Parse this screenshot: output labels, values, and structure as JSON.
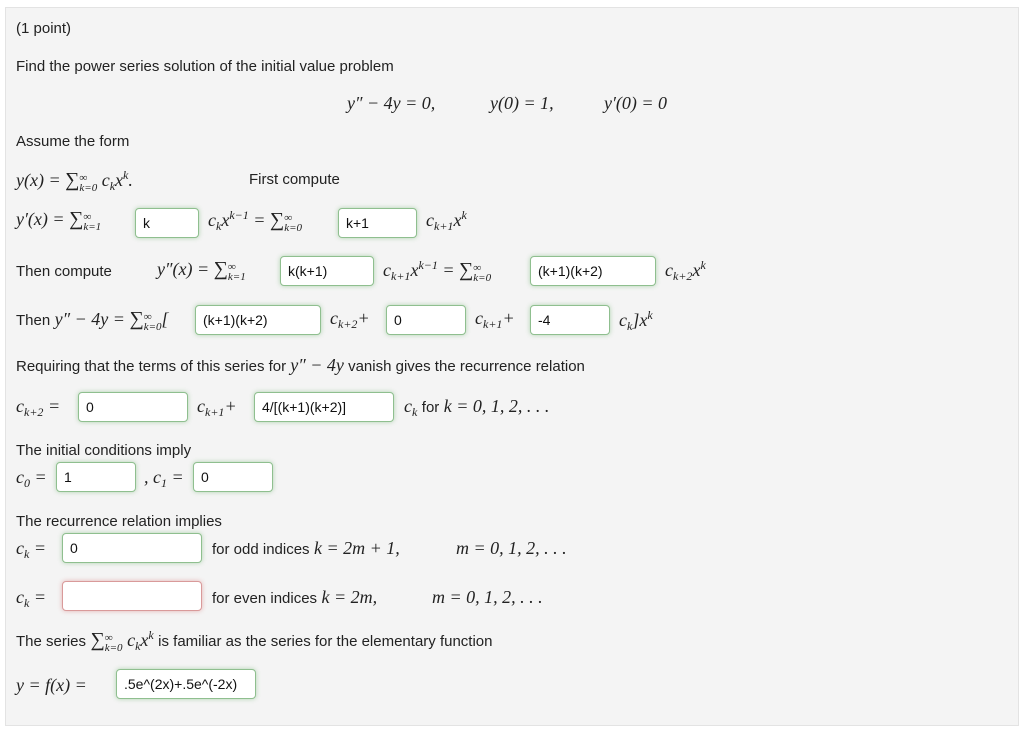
{
  "problem": {
    "points": "(1 point)",
    "intro": "Find the power series solution of the initial value problem",
    "equation": {
      "ode": "y″ − 4y = 0,",
      "ic1": "y(0) = 1,",
      "ic2": "y′(0) = 0"
    },
    "assume": "Assume the form",
    "first_compute": "First compute",
    "then_compute": "Then compute",
    "then": "Then",
    "requiring": "Requiring that the terms of this series for",
    "requiring_math": "y″ − 4y",
    "requiring_end": "vanish gives the recurrence relation",
    "for_k": "for",
    "k_range": "k = 0, 1, 2, . . .",
    "initial_conditions": "The initial conditions imply",
    "recurrence_implies": "The recurrence relation implies",
    "odd_label": "for odd indices",
    "odd_math": "k = 2m + 1,",
    "even_label": "for even indices",
    "even_math": "k = 2m,",
    "m_range": "m = 0, 1, 2, . . .",
    "series_prefix": "The series",
    "series_suffix": "is familiar as the series for the elementary function"
  },
  "answers": {
    "yprime_coef1": "k",
    "yprime_coef2": "k+1",
    "ydprime_coef1": "k(k+1)",
    "ydprime_coef2": "(k+1)(k+2)",
    "combined_ck2": "(k+1)(k+2)",
    "combined_ck1": "0",
    "combined_ck": "-4",
    "recur_ck1": "0",
    "recur_ck": "4/[(k+1)(k+2)]",
    "c0": "1",
    "c1": "0",
    "ck_odd": "0",
    "ck_even": "",
    "f_x": ".5e^(2x)+.5e^(-2x)"
  },
  "answer_status": {
    "correct_color": "#8fbf8f",
    "incorrect_color": "#d99a9a"
  }
}
